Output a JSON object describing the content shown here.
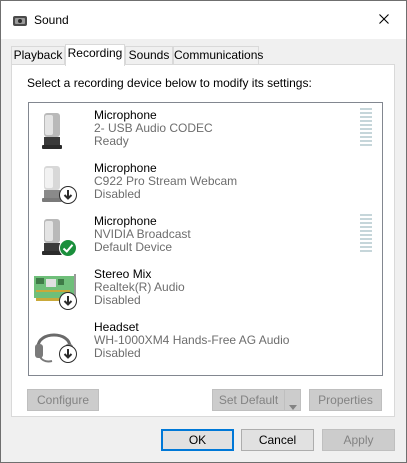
{
  "window": {
    "title": "Sound"
  },
  "icons": {
    "app": "speaker-icon",
    "close": "close-icon",
    "microphone": "microphone-icon",
    "webcam_mic": "webcam-microphone-icon",
    "stereo_mix": "sound-card-icon",
    "headset": "headset-icon",
    "disabled_badge": "down-arrow-badge-icon",
    "default_badge": "checkmark-badge-icon"
  },
  "tabs": [
    {
      "label": "Playback",
      "active": false
    },
    {
      "label": "Recording",
      "active": true
    },
    {
      "label": "Sounds",
      "active": false
    },
    {
      "label": "Communications",
      "active": false
    }
  ],
  "recording": {
    "instructions": "Select a recording device below to modify its settings:",
    "devices": [
      {
        "name": "Microphone",
        "description": "2- USB Audio CODEC",
        "status": "Ready",
        "badge": "",
        "level_meter": true
      },
      {
        "name": "Microphone",
        "description": "C922 Pro Stream Webcam",
        "status": "Disabled",
        "badge": "disabled",
        "level_meter": false
      },
      {
        "name": "Microphone",
        "description": "NVIDIA Broadcast",
        "status": "Default Device",
        "badge": "default",
        "level_meter": true
      },
      {
        "name": "Stereo Mix",
        "description": "Realtek(R) Audio",
        "status": "Disabled",
        "badge": "disabled",
        "level_meter": false
      },
      {
        "name": "Headset",
        "description": "WH-1000XM4 Hands-Free AG Audio",
        "status": "Disabled",
        "badge": "disabled",
        "level_meter": false
      }
    ],
    "buttons": {
      "configure": "Configure",
      "set_default": "Set Default",
      "properties": "Properties"
    }
  },
  "footer": {
    "ok": "OK",
    "cancel": "Cancel",
    "apply": "Apply"
  },
  "colors": {
    "accent": "#0078d7",
    "default_badge": "#1a8f3c",
    "level_meter": "#c6d6da"
  }
}
